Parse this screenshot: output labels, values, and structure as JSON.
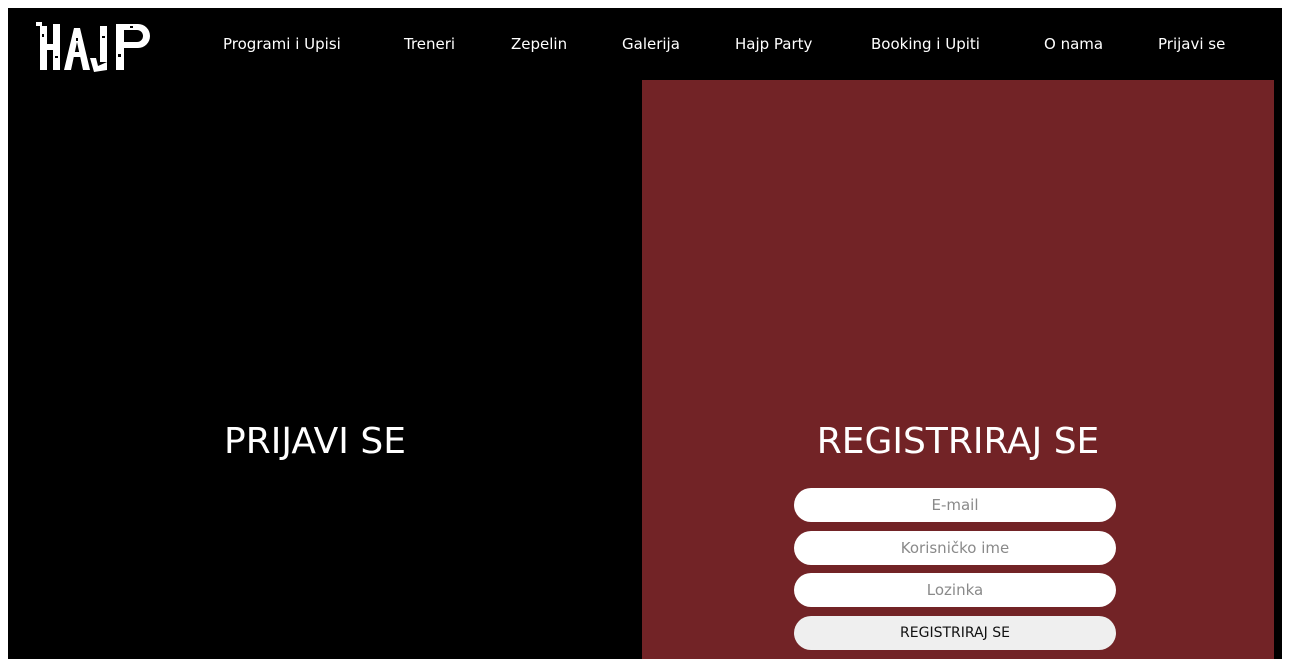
{
  "brand": {
    "logo_text": "HAJP",
    "logo_icon": "hajp-logo"
  },
  "nav": {
    "items": [
      {
        "label": "Programi i Upisi"
      },
      {
        "label": "Treneri"
      },
      {
        "label": "Zepelin"
      },
      {
        "label": "Galerija"
      },
      {
        "label": "Hajp Party"
      },
      {
        "label": "Booking i Upiti"
      },
      {
        "label": "O nama"
      },
      {
        "label": "Prijavi se"
      }
    ]
  },
  "login": {
    "title": "PRIJAVI SE"
  },
  "register": {
    "title": "REGISTRIRAJ SE",
    "email_placeholder": "E-mail",
    "username_placeholder": "Korisničko ime",
    "password_placeholder": "Lozinka",
    "submit_label": "REGISTRIRAJ SE"
  },
  "colors": {
    "background": "#000000",
    "panel": "#722326",
    "text": "#ffffff",
    "button": "#efefef"
  }
}
